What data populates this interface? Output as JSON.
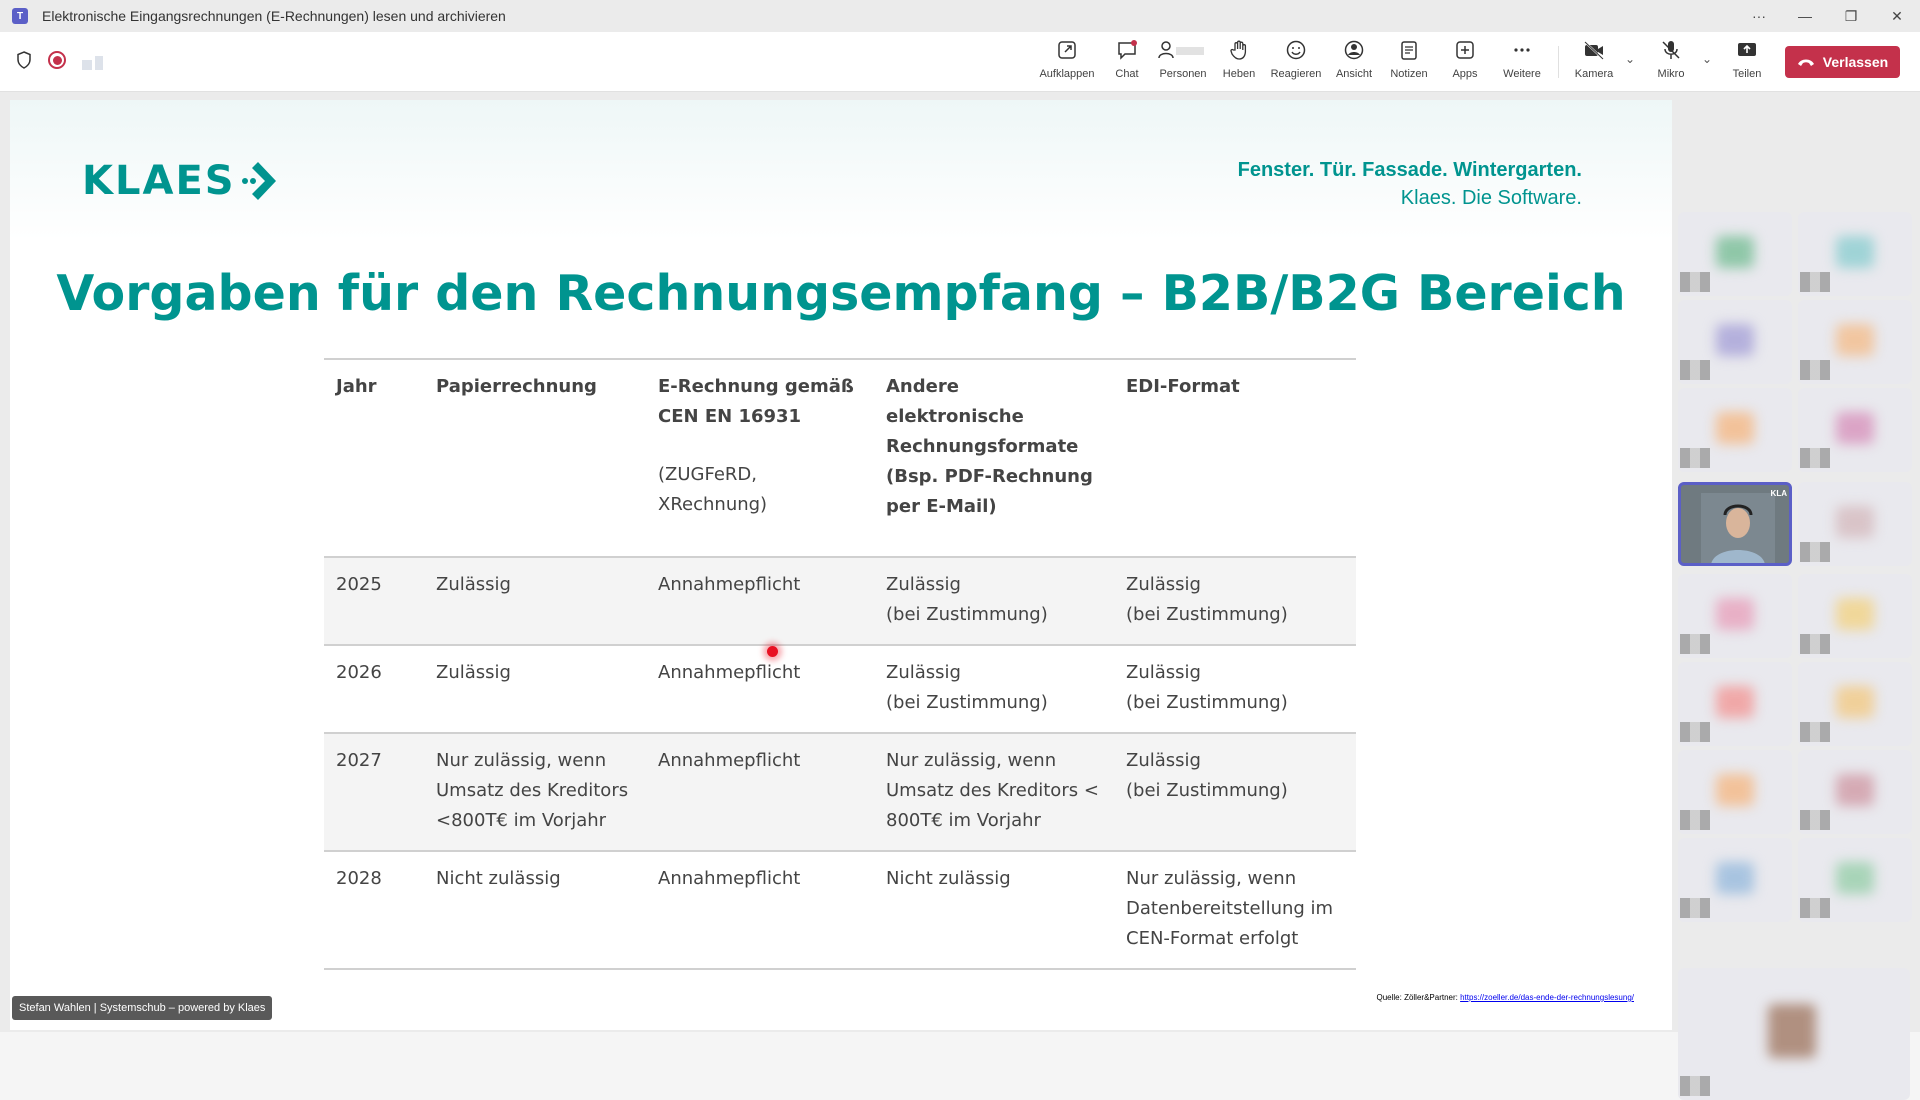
{
  "window": {
    "app_icon": "teams-icon",
    "title": "Elektronische Eingangsrechnungen (E-Rechnungen) lesen und archivieren",
    "controls": [
      "···",
      "—",
      "❐",
      "✕"
    ]
  },
  "toolbar": {
    "buttons": [
      {
        "label": "Aufklappen",
        "icon": "popout-icon"
      },
      {
        "label": "Chat",
        "icon": "chat-icon"
      },
      {
        "label": "Personen",
        "icon": "people-icon"
      },
      {
        "label": "Heben",
        "icon": "raise-hand-icon"
      },
      {
        "label": "Reagieren",
        "icon": "react-icon"
      },
      {
        "label": "Ansicht",
        "icon": "view-icon"
      },
      {
        "label": "Notizen",
        "icon": "notes-icon"
      },
      {
        "label": "Apps",
        "icon": "apps-icon"
      },
      {
        "label": "Weitere",
        "icon": "more-icon"
      },
      {
        "label": "Kamera",
        "icon": "camera-off-icon"
      },
      {
        "label": "Mikro",
        "icon": "mic-off-icon"
      },
      {
        "label": "Teilen",
        "icon": "share-icon"
      }
    ],
    "leave_label": "Verlassen",
    "colors": {
      "leave": "#c4314b",
      "accent": "#5b5fc7"
    }
  },
  "slide": {
    "logo_text": "KLAES",
    "tagline_1": "Fenster. Tür. Fassade. Wintergarten.",
    "tagline_2": "Klaes. Die Software.",
    "title": "Vorgaben für den Rechnungsempfang – B2B/B2G Bereich",
    "accent_color": "#00948f",
    "table": {
      "headers": {
        "jahr": "Jahr",
        "papier": "Papierrechnung",
        "erech": "E-Rechnung gemäß CEN EN 16931",
        "erech_sub": "(ZUGFeRD, XRechnung)",
        "andere": "Andere elektronische Rechnungsformate (Bsp. PDF-Rechnung per E-Mail)",
        "edi": "EDI-Format"
      },
      "rows": [
        {
          "jahr": "2025",
          "papier": "Zulässig",
          "erech": "Annahmepflicht",
          "andere": "Zulässig\n(bei Zustimmung)",
          "edi": "Zulässig\n(bei Zustimmung)"
        },
        {
          "jahr": "2026",
          "papier": "Zulässig",
          "erech": "Annahmepflicht",
          "andere": "Zulässig\n(bei Zustimmung)",
          "edi": "Zulässig\n(bei Zustimmung)"
        },
        {
          "jahr": "2027",
          "papier": "Nur zulässig, wenn Umsatz des Kreditors <800T€ im Vorjahr",
          "erech": "Annahmepflicht",
          "andere": "Nur zulässig, wenn Umsatz des Kreditors < 800T€ im Vorjahr",
          "edi": "Zulässig\n(bei Zustimmung)"
        },
        {
          "jahr": "2028",
          "papier": "Nicht zulässig",
          "erech": "Annahmepflicht",
          "andere": "Nicht zulässig",
          "edi": "Nur zulässig, wenn Datenbereitstellung im CEN-Format erfolgt"
        }
      ]
    },
    "source_label": "Quelle: Zöller&Partner:",
    "source_link": "https://zoeller.de/das-ende-der-rechnungslesung/"
  },
  "presenter_label": "Stefan Wahlen | Systemschub – powered by Klaes",
  "active_tile_label": "KLA"
}
